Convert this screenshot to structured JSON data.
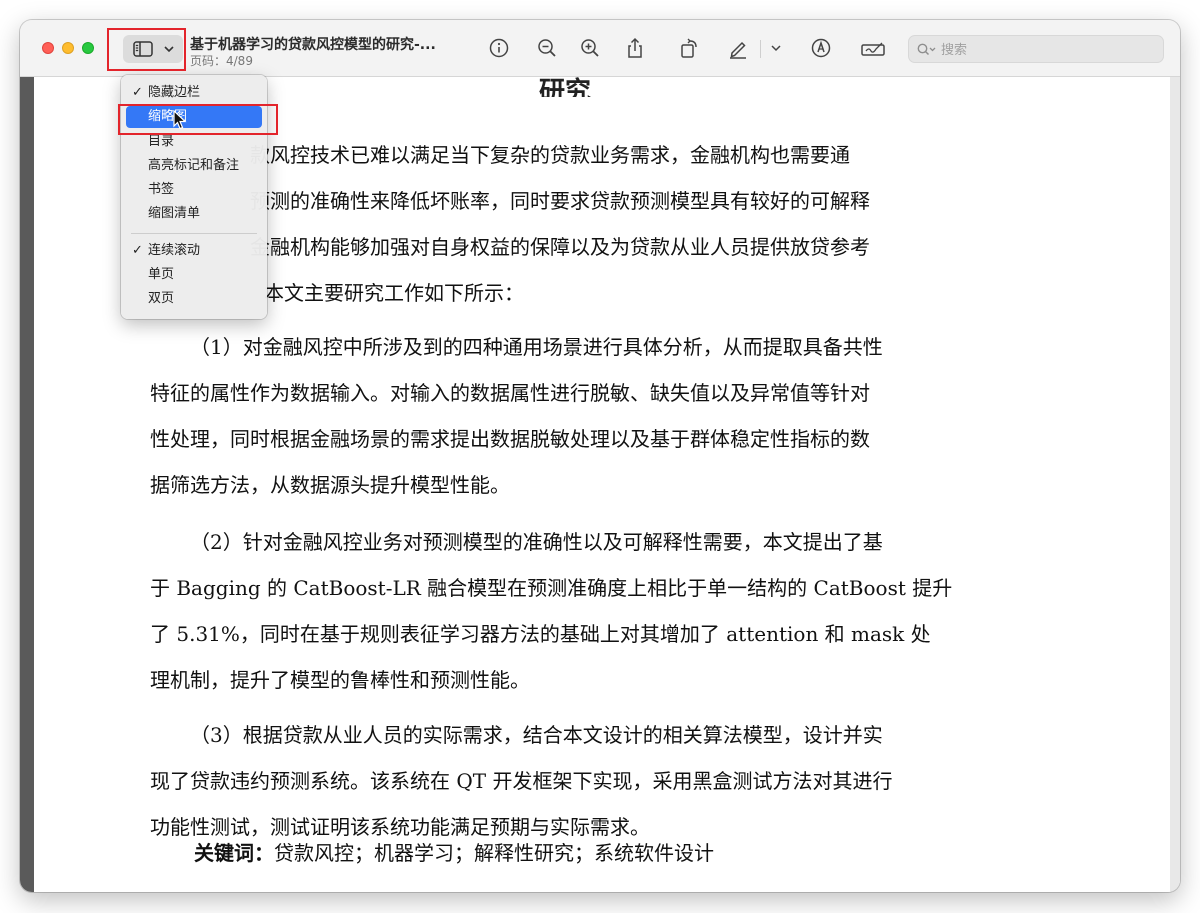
{
  "window": {
    "title": "基于机器学习的贷款风控模型的研究-...",
    "page_indicator": "页码：4/89"
  },
  "search": {
    "placeholder": "搜索"
  },
  "toolbar": {
    "icons": [
      "sidebar-icon",
      "info-icon",
      "zoom-out-icon",
      "zoom-in-icon",
      "share-icon",
      "rotate-icon",
      "markup-pen-icon",
      "chevron-down-icon",
      "annotate-icon",
      "signature-icon",
      "search-icon"
    ]
  },
  "sidebar_menu": {
    "items": [
      {
        "label": "隐藏边栏",
        "checked": true
      },
      {
        "label": "缩略图",
        "checked": false,
        "selected": true
      },
      {
        "label": "目录",
        "checked": false
      },
      {
        "label": "高亮标记和备注",
        "checked": false
      },
      {
        "label": "书签",
        "checked": false
      },
      {
        "label": "缩图清单",
        "checked": false
      },
      {
        "label": "连续滚动",
        "checked": true
      },
      {
        "label": "单页",
        "checked": false
      },
      {
        "label": "双页",
        "checked": false
      }
    ],
    "check_mark": "✓"
  },
  "document": {
    "top_fragment": "研究",
    "intro": [
      "款风控技术已难以满足当下复杂的贷款业务需求，金融机构也需要通",
      "预测的准确性来降低坏账率，同时要求贷款预测模型具有较好的可解释",
      "金融机构能够加强对自身权益的保障以及为贷款从业人员提供放贷参考",
      "本文主要研究工作如下所示："
    ],
    "p1": [
      "（1）对金融风控中所涉及到的四种通用场景进行具体分析，从而提取具备共性",
      "特征的属性作为数据输入。对输入的数据属性进行脱敏、缺失值以及异常值等针对",
      "性处理，同时根据金融场景的需求提出数据脱敏处理以及基于群体稳定性指标的数",
      "据筛选方法，从数据源头提升模型性能。"
    ],
    "p2": [
      "（2）针对金融风控业务对预测模型的准确性以及可解释性需要，本文提出了基",
      "于 Bagging 的 CatBoost-LR 融合模型在预测准确度上相比于单一结构的 CatBoost 提升",
      "了 5.31%，同时在基于规则表征学习器方法的基础上对其增加了 attention 和 mask 处",
      "理机制，提升了模型的鲁棒性和预测性能。"
    ],
    "p3": [
      "（3）根据贷款从业人员的实际需求，结合本文设计的相关算法模型，设计并实",
      "现了贷款违约预测系统。该系统在 QT 开发框架下实现，采用黑盒测试方法对其进行",
      "功能性测试，测试证明该系统功能满足预期与实际需求。"
    ],
    "keywords_label": "关键词：",
    "keywords": "贷款风控；机器学习；解释性研究；系统软件设计"
  },
  "colors": {
    "highlight": "#e3242b",
    "menu_selected": "#3478f6"
  }
}
